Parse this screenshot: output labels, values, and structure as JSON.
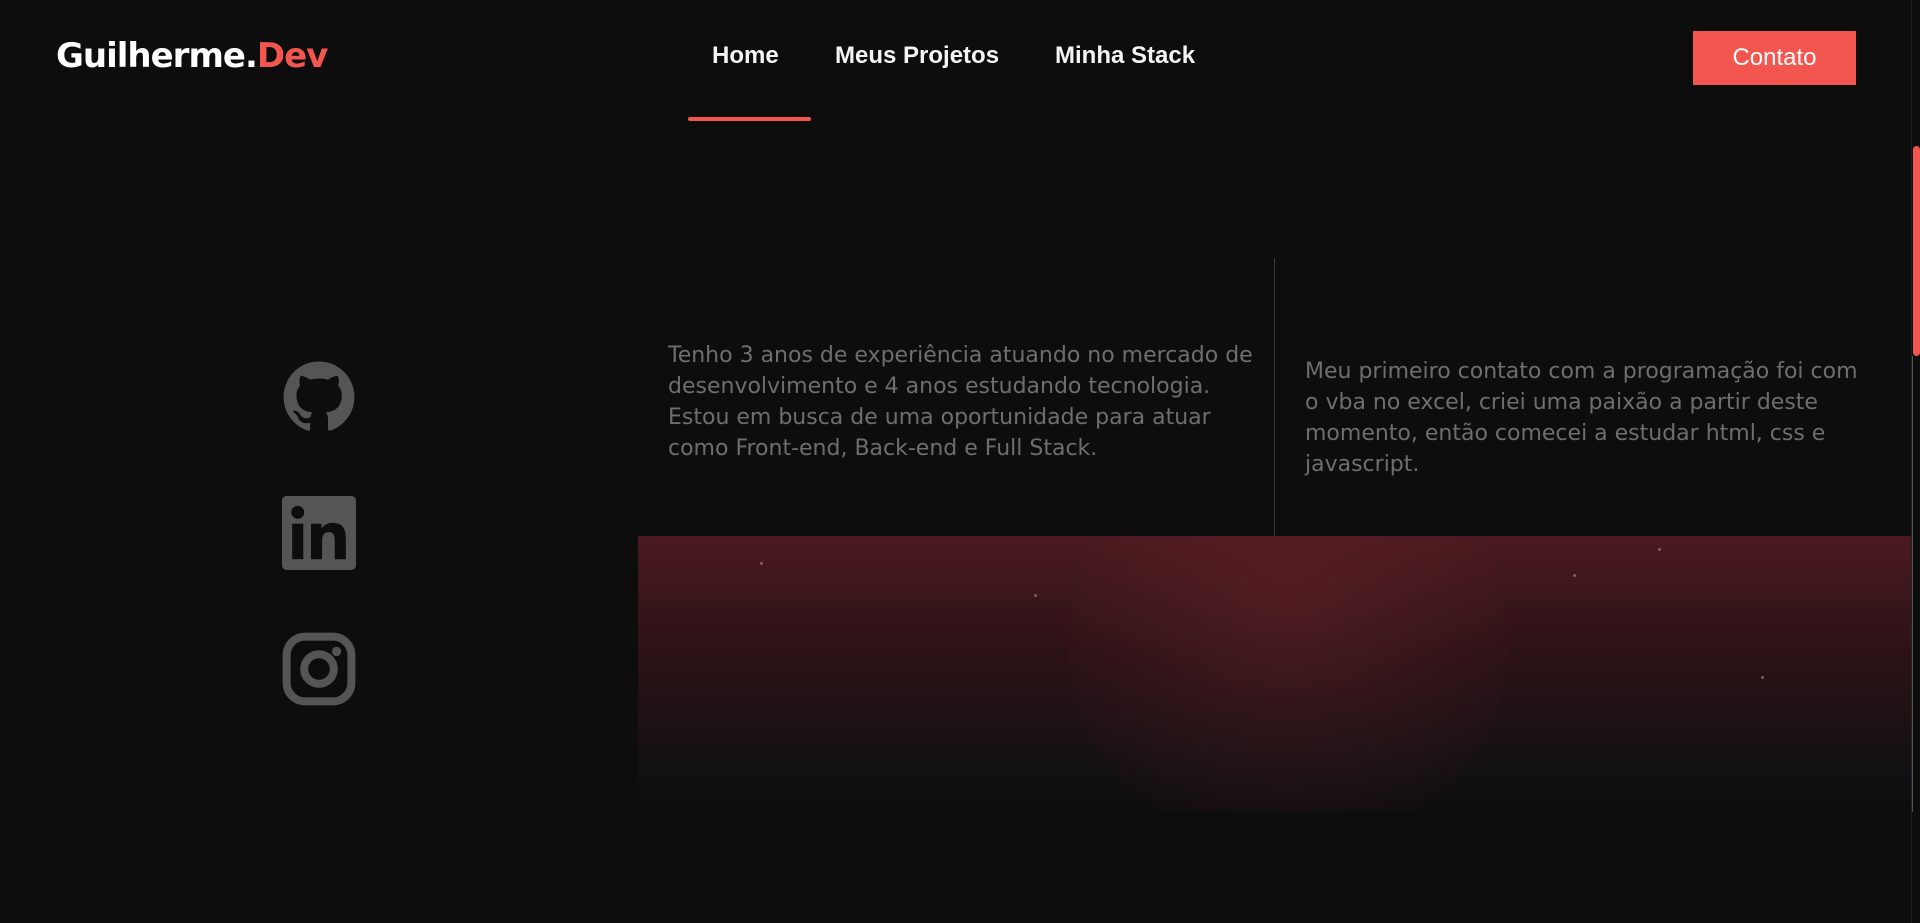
{
  "brand": {
    "name": "Guilherme.",
    "accent": "Dev"
  },
  "nav": {
    "links": [
      "Home",
      "Meus Projetos",
      "Minha Stack"
    ],
    "active": "Home",
    "cta_label": "Contato"
  },
  "socials": [
    {
      "icon": "github-icon"
    },
    {
      "icon": "linkedin-icon"
    },
    {
      "icon": "instagram-icon"
    }
  ],
  "about": {
    "paragraph_1": "Tenho 3 anos de experiência atuando no mercado de desenvolvimento e 4 anos estudando tecnologia. Estou em busca de uma oportunidade para atuar como Front-end, Back-end e Full Stack.",
    "paragraph_2": "Meu primeiro contato com a programação foi com o vba no excel, criei uma paixão a partir deste momento, então comecei a estudar html, css e javascript."
  },
  "colors": {
    "accent": "#f2564f",
    "background": "#0d0d0e",
    "muted_text": "#6e6e6e",
    "icon_gray": "#555555"
  }
}
